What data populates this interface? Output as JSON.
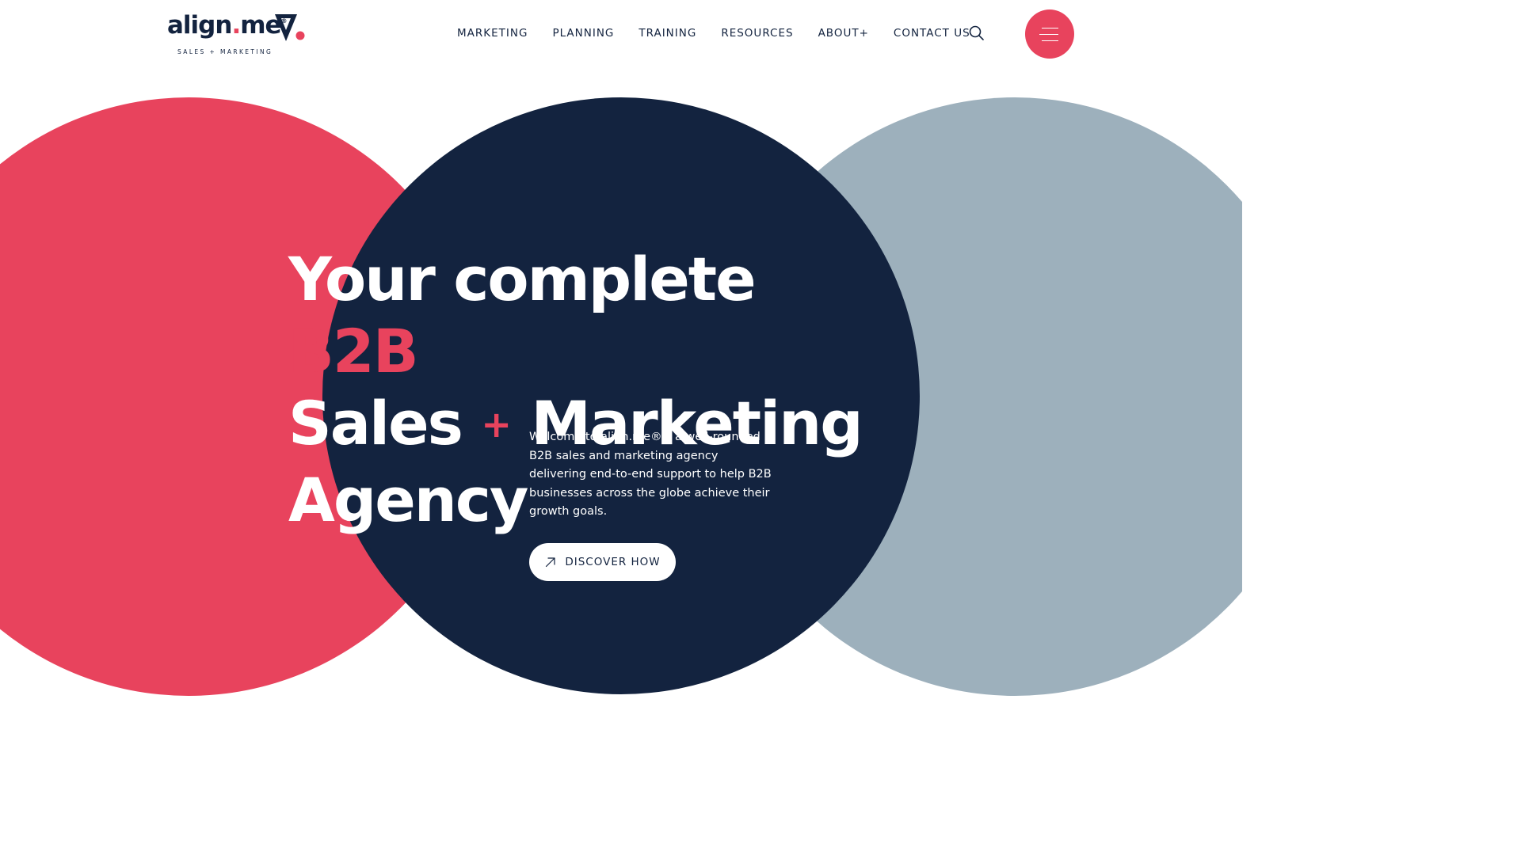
{
  "brand": {
    "word": "align",
    "dot": ".",
    "suffix": "me",
    "registered": "®",
    "tagline": "SALES + MARKETING"
  },
  "nav": {
    "items": [
      {
        "label": "MARKETING"
      },
      {
        "label": "PLANNING"
      },
      {
        "label": "TRAINING"
      },
      {
        "label": "RESOURCES"
      },
      {
        "label": "ABOUT+"
      },
      {
        "label": "CONTACT US"
      }
    ]
  },
  "icons": {
    "search": "search-icon",
    "menu": "hamburger-menu-icon",
    "cta": "arrow-up-right-icon"
  },
  "hero": {
    "headline_part1": "Your complete ",
    "headline_accent": "B2B",
    "headline_part2": "Sales ",
    "headline_plus": "+",
    "headline_part3": " Marketing Agency",
    "intro": "Welcome to align.me® – a well-rounded B2B sales and marketing agency delivering end-to-end support to help B2B businesses across the globe achieve their growth goals.",
    "cta_label": "DISCOVER HOW"
  },
  "colors": {
    "brand_red": "#e8435d",
    "brand_navy": "#13233f",
    "brand_grey": "#9db0bc",
    "background": "#ffffff"
  }
}
